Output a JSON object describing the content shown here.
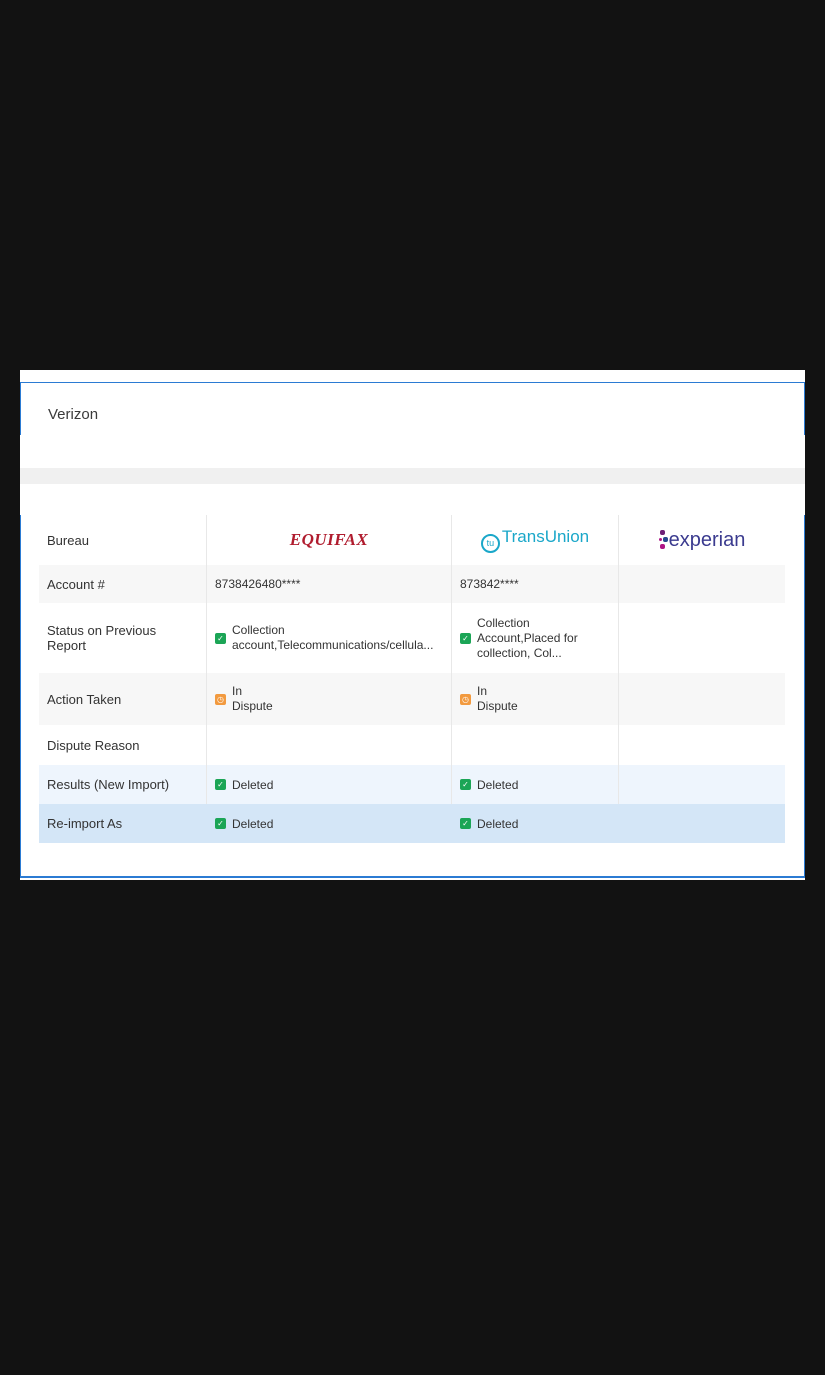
{
  "account": {
    "creditor": "Verizon"
  },
  "table": {
    "rows": {
      "bureau": {
        "label": "Bureau"
      },
      "account_number": {
        "label": "Account #",
        "equifax": "8738426480****",
        "transunion": "873842****",
        "experian": ""
      },
      "status_previous": {
        "label": "Status on Previous\nReport",
        "equifax": "Collection\naccount,Telecommunications/cellula...",
        "transunion": "Collection\nAccount,Placed for\ncollection, Col...",
        "experian": ""
      },
      "action_taken": {
        "label": "Action Taken",
        "equifax": "In\nDispute",
        "transunion": "In\nDispute",
        "experian": ""
      },
      "dispute_reason": {
        "label": "Dispute Reason",
        "equifax": "",
        "transunion": "",
        "experian": ""
      },
      "results_new_import": {
        "label": "Results (New Import)",
        "equifax": "Deleted",
        "transunion": "Deleted",
        "experian": ""
      },
      "reimport_as": {
        "label": "Re-import As",
        "equifax": "Deleted",
        "transunion": "Deleted",
        "experian": ""
      }
    },
    "bureaus": {
      "equifax": "EQUIFAX",
      "transunion": "TransUnion",
      "transunion_mark": "tu",
      "experian": "experian"
    }
  },
  "colors": {
    "accent_border": "#2b7bd3",
    "success": "#1ba556",
    "pending": "#f29a3f",
    "equifax_brand": "#b01c2e",
    "transunion_brand": "#1aa7c9",
    "experian_brand": "#3b3b8f"
  },
  "icons": {
    "success": "check-square-icon",
    "pending": "clock-icon"
  }
}
